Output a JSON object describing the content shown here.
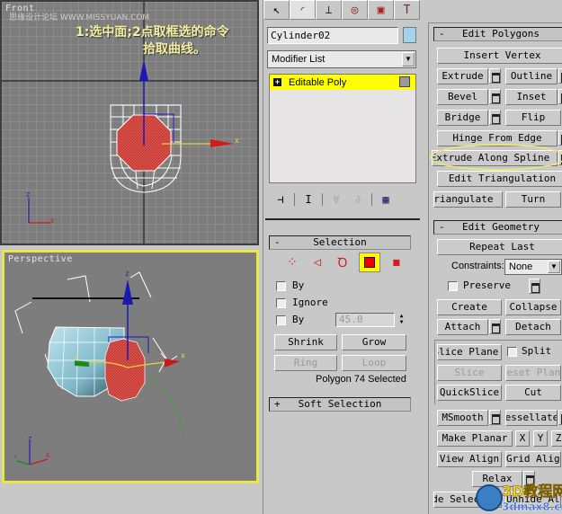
{
  "viewports": {
    "front": {
      "label": "Front",
      "watermark": "思缘设计论坛 WWW.MISSYUAN.COM",
      "annotation_line1": "1:选中面;2点取框选的命令",
      "annotation_line2": "拾取曲线。",
      "axis_x": "x",
      "tripod_z": "Z",
      "tripod_x": "X"
    },
    "perspective": {
      "label": "Perspective",
      "gizmo_z": "z",
      "gizmo_x": "x",
      "gizmo_y": "y",
      "tripod_z": "Z",
      "tripod_x": "X",
      "tripod_y": "Y"
    }
  },
  "command_panel": {
    "tabs": [
      {
        "name": "create",
        "icon": "cursor-star-icon"
      },
      {
        "name": "modify",
        "icon": "modify-arc-icon"
      },
      {
        "name": "hierarchy",
        "icon": "hierarchy-icon"
      },
      {
        "name": "motion",
        "icon": "motion-wheel-icon"
      },
      {
        "name": "display",
        "icon": "display-monitor-icon"
      },
      {
        "name": "utilities",
        "icon": "hammer-icon"
      }
    ],
    "object_name": "Cylinder02",
    "object_color": "#9fd4ea",
    "modifier_list": "Modifier List",
    "stack": [
      {
        "label": "Editable Poly",
        "expand": "+"
      }
    ],
    "stack_tools": [
      "pin-stack-icon",
      "show-end-result-icon",
      "make-unique-icon",
      "remove-modifier-icon",
      "configure-sets-icon"
    ],
    "selection": {
      "sign": "-",
      "title": "Selection",
      "modes": [
        "vertex",
        "edge",
        "border",
        "polygon",
        "element"
      ],
      "active_mode": "polygon",
      "by_vertex_label": "By",
      "ignore_label": "Ignore",
      "by_angle_label": "By",
      "angle_value": "45.0",
      "shrink": "Shrink",
      "grow": "Grow",
      "ring": "Ring",
      "loop": "Loop",
      "status": "Polygon 74 Selected"
    },
    "soft_selection": {
      "sign": "+",
      "title": "Soft Selection"
    }
  },
  "edit_polygons": {
    "sign": "-",
    "title": "Edit Polygons",
    "insert_vertex": "Insert Vertex",
    "extrude": "Extrude",
    "outline": "Outline",
    "bevel": "Bevel",
    "inset": "Inset",
    "bridge": "Bridge",
    "flip": "Flip",
    "hinge_from_edge": "Hinge From Edge",
    "extrude_along_spline": "Extrude Along Spline",
    "edit_triangulation": "Edit Triangulation",
    "retriangulate": "Retriangulate",
    "turn": "Turn"
  },
  "edit_geometry": {
    "sign": "-",
    "title": "Edit Geometry",
    "repeat_last": "Repeat Last",
    "constraints_label": "Constraints:",
    "constraints_value": "None",
    "preserve": "Preserve",
    "create": "Create",
    "collapse": "Collapse",
    "attach": "Attach",
    "detach": "Detach",
    "slice_plane": "Slice Plane",
    "split": "Split",
    "slice": "Slice",
    "reset_plane": "Reset Plane",
    "quickslice": "QuickSlice",
    "cut": "Cut",
    "msmooth": "MSmooth",
    "tessellate": "Tessellate",
    "make_planar": "Make Planar",
    "x": "X",
    "y": "Y",
    "z": "Z",
    "view_align": "View Align",
    "grid_align": "Grid Align",
    "relax": "Relax",
    "hide_selected": "Hide Selected",
    "unhide_all": "Unhide All"
  },
  "logo": {
    "line1": "3D教程网",
    "line2": "3dmax8.cn"
  },
  "colors": {
    "selection_highlight": "#ffff00",
    "viewport_bg": "#7d7d7d",
    "active_viewport_border": "#e8e84a",
    "selected_face": "#c83a32",
    "annotation_text": "#f4f0a0"
  }
}
